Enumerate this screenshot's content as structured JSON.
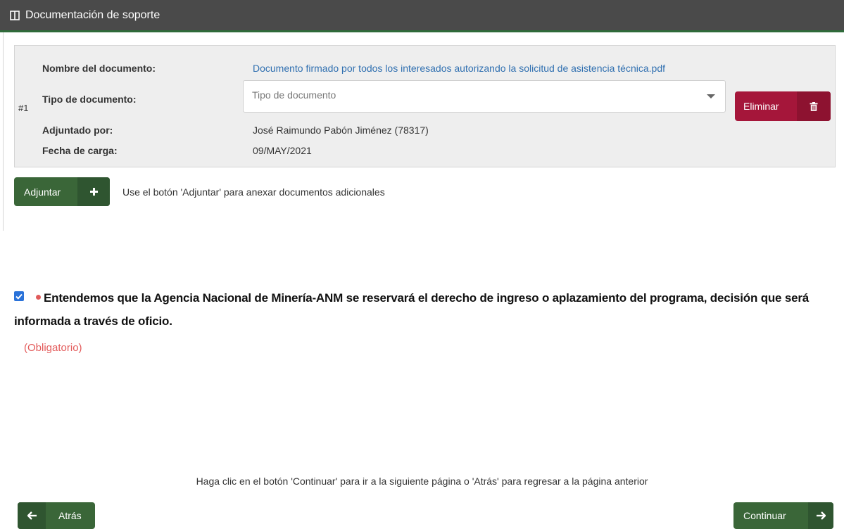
{
  "header": {
    "title": "Documentación de soporte",
    "icon": "panel-icon"
  },
  "document": {
    "number": "#1",
    "name_label": "Nombre del documento:",
    "name_value": "Documento firmado por todos los interesados autorizando la solicitud de asistencia técnica.pdf",
    "type_label": "Tipo de documento:",
    "type_placeholder": "Tipo de documento",
    "uploaded_by_label": "Adjuntado por:",
    "uploaded_by_value": "José Raimundo Pabón Jiménez (78317)",
    "date_label": "Fecha de carga:",
    "date_value": "09/MAY/2021",
    "delete_button": "Eliminar"
  },
  "attach": {
    "button_label": "Adjuntar",
    "hint": "Use el botón 'Adjuntar' para anexar documentos adicionales"
  },
  "agreement": {
    "checked": true,
    "text": "Entendemos que la Agencia Nacional de Minería-ANM se reservará el derecho de ingreso o aplazamiento del programa, decisión que será informada a través de oficio.",
    "required_label": "(Obligatorio)"
  },
  "footer": {
    "note": "Haga clic en el botón 'Continuar' para ir a la siguiente página o 'Atrás' para regresar a la página anterior",
    "back_label": "Atrás",
    "continue_label": "Continuar"
  },
  "colors": {
    "header_bg": "#4a4a4a",
    "accent_green": "#3a6638",
    "danger": "#a5163a",
    "link": "#2f6fb0",
    "required": "#e35b5b"
  }
}
